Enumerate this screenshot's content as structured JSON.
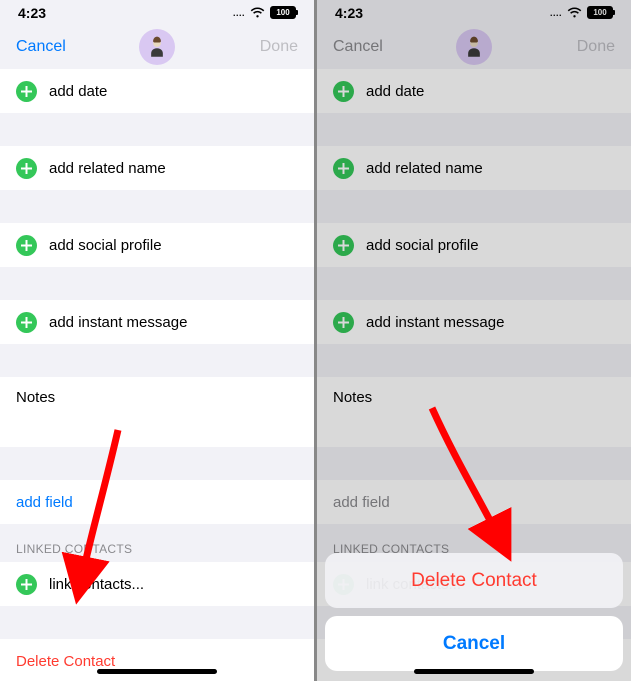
{
  "status": {
    "time": "4:23",
    "dots": "....",
    "battery": "100"
  },
  "nav": {
    "cancel": "Cancel",
    "done": "Done"
  },
  "colors": {
    "link": "#007aff",
    "disabled": "#bdbdc2",
    "destructive": "#ff3b30",
    "addGreen": "#34c759"
  },
  "rows": {
    "addDate": "add date",
    "addRelatedName": "add related name",
    "addSocialProfile": "add social profile",
    "addInstantMessage": "add instant message",
    "notes": "Notes",
    "addField": "add field",
    "linkedHeader": "LINKED CONTACTS",
    "linkContacts": "link contacts...",
    "deleteContact": "Delete Contact"
  },
  "sheet": {
    "delete": "Delete Contact",
    "cancel": "Cancel"
  }
}
